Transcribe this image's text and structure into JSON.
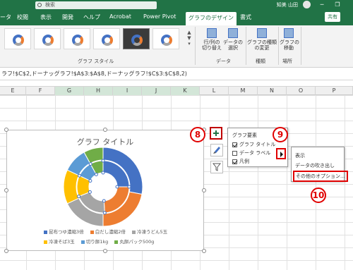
{
  "titlebar": {
    "search_placeholder": "検索",
    "user": "知美 山田",
    "minimize": "─",
    "restore": "❐"
  },
  "tabs": [
    {
      "label": "ータ"
    },
    {
      "label": "校閲"
    },
    {
      "label": "表示"
    },
    {
      "label": "開発"
    },
    {
      "label": "ヘルプ"
    },
    {
      "label": "Acrobat"
    },
    {
      "label": "Power Pivot"
    },
    {
      "label": "グラフのデザイン",
      "active": true
    },
    {
      "label": "書式"
    }
  ],
  "share_label": "共有",
  "ribbon": {
    "chart_styles_label": "グラフ スタイル",
    "buttons": [
      {
        "label": "行/列の\n切り替え"
      },
      {
        "label": "データの\n選択"
      },
      {
        "label": "グラフの種類\nの変更"
      },
      {
        "label": "グラフの\n移動"
      }
    ],
    "group_data": "データ",
    "group_type": "種類",
    "group_location": "場所"
  },
  "formula": "ラフ!$C$2,ドーナッグラフ!$A$3:$A$8,ドーナッグラフ!$C$3:$C$8,2)",
  "columns": [
    "E",
    "F",
    "G",
    "H",
    "I",
    "J",
    "K",
    "L",
    "M",
    "N",
    "O",
    "P"
  ],
  "chart": {
    "title": "グラフ タイトル",
    "legend": [
      {
        "label": "昆布つゆ濃縮3倍",
        "color": "#4472c4"
      },
      {
        "label": "白だし濃縮2倍",
        "color": "#ed7d31"
      },
      {
        "label": "冷凍うどん5玉",
        "color": "#a5a5a5"
      },
      {
        "label": "冷凍そば3玉",
        "color": "#ffc000"
      },
      {
        "label": "切り餅1kg",
        "color": "#5b9bd5"
      },
      {
        "label": "丸餅パック500g",
        "color": "#70ad47"
      }
    ]
  },
  "chart_data": {
    "type": "pie",
    "title": "グラフ タイトル",
    "categories": [
      "昆布つゆ濃縮3倍",
      "白だし濃縮2倍",
      "冷凍うどん5玉",
      "冷凍そば3玉",
      "切り餅1kg",
      "丸餅パック500g"
    ],
    "series": [
      {
        "values": [
          28,
          22,
          18,
          14,
          10,
          8
        ]
      },
      {
        "values": [
          25,
          24,
          20,
          13,
          10,
          8
        ]
      }
    ]
  },
  "callouts": {
    "c8": "8",
    "c9": "9",
    "c10": "10"
  },
  "chart_elements": {
    "title": "グラフ要素",
    "items": [
      {
        "label": "グラフ タイトル",
        "checked": true
      },
      {
        "label": "データ ラベル",
        "checked": false
      },
      {
        "label": "凡例",
        "checked": true
      }
    ]
  },
  "submenu": {
    "items": [
      "表示",
      "データの吹き出し",
      "その他のオプション..."
    ]
  }
}
